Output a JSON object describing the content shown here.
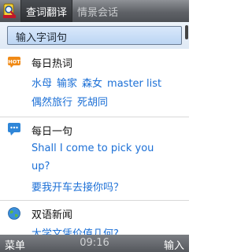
{
  "header": {
    "tabs": [
      {
        "label": "查词翻译",
        "active": true
      },
      {
        "label": "情景会话",
        "active": false
      }
    ]
  },
  "search": {
    "placeholder": "输入字词句"
  },
  "sections": {
    "hot_words": {
      "title": "每日热词",
      "icon": "hot-icon",
      "line1": [
        "水母",
        "输家",
        "森女",
        "master list"
      ],
      "line2": [
        "偶然旅行",
        "死胡同"
      ]
    },
    "daily_sentence": {
      "title": "每日一句",
      "icon": "speech-bubble-icon",
      "english_line1": "Shall I come to pick you",
      "english_line2": "up?",
      "chinese": "要我开车去接你吗？"
    },
    "bilingual_news": {
      "title": "双语新闻",
      "icon": "globe-icon",
      "headline": "大学文凭价值几何?"
    }
  },
  "footer": {
    "left_soft_key": "菜单",
    "clock": "09:16",
    "right_soft_key": "输入"
  },
  "colors": {
    "link": "#1b6fd6",
    "header_bg": "#5f6267",
    "search_bg": "#bcd5f3"
  }
}
